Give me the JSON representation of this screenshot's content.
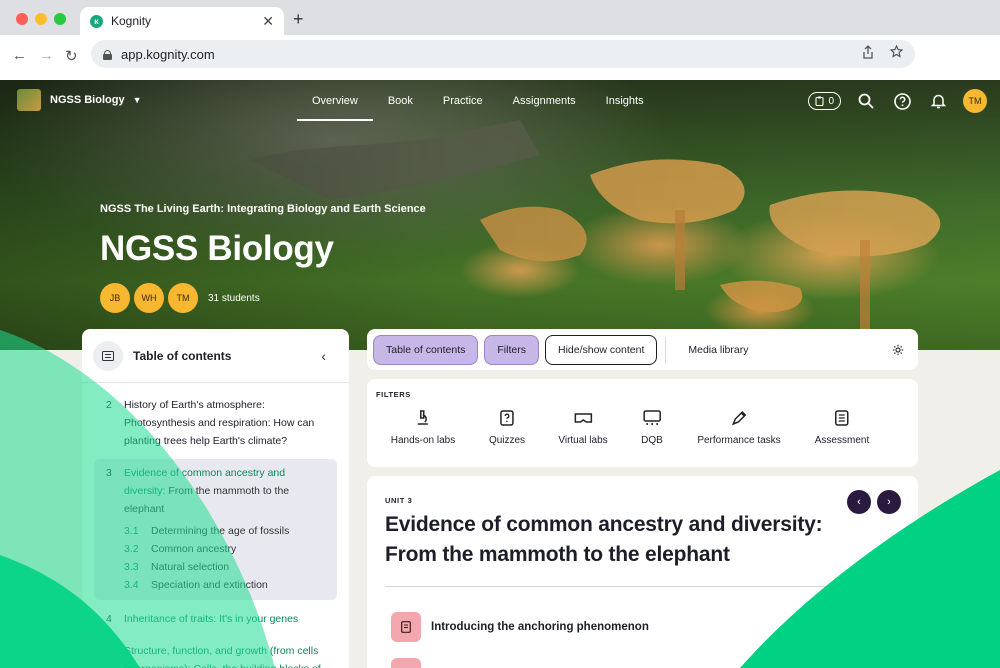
{
  "browser": {
    "tab_title": "Kognity",
    "tab_favicon": "kognity-logo-icon",
    "url": "app.kognity.com"
  },
  "nav": {
    "course_name": "NGSS Biology",
    "links": [
      "Overview",
      "Book",
      "Practice",
      "Assignments",
      "Insights"
    ],
    "active_link": "Overview",
    "notification_count": "0",
    "user_initials": "TM"
  },
  "hero": {
    "subtitle": "NGSS The Living Earth: Integrating Biology and Earth Science",
    "title": "NGSS Biology",
    "student_avatars": [
      "JB",
      "WH",
      "TM"
    ],
    "student_count": "31 students"
  },
  "toc": {
    "title": "Table of contents",
    "items": [
      {
        "num": "2",
        "label": "History of Earth's atmosphere: Photosynthesis and respiration: How can planting trees help Earth's climate?"
      }
    ],
    "active": {
      "num": "3",
      "label_green": "Evidence of common ancestry and diversity:",
      "label_rest": " From the mammoth to the elephant",
      "subitems": [
        {
          "num": "3.1",
          "label": "Determining the age of fossils"
        },
        {
          "num": "3.2",
          "label": "Common ancestry"
        },
        {
          "num": "3.3",
          "label": "Natural selection"
        },
        {
          "num": "3.4",
          "label": "Speciation and extinction"
        }
      ]
    },
    "after": [
      {
        "num": "4",
        "label": "Inheritance of traits: It's in your genes"
      },
      {
        "num": "",
        "label": "Structure, function, and growth (from cells to organisms): Cells, the building blocks of"
      }
    ]
  },
  "tabs": {
    "table_of_contents": "Table of contents",
    "filters": "Filters",
    "hide_show": "Hide/show content",
    "media_library": "Media library"
  },
  "filters": {
    "heading": "FILTERS",
    "items": [
      "Hands-on labs",
      "Quizzes",
      "Virtual labs",
      "DQB",
      "Performance tasks",
      "Assessment"
    ]
  },
  "unit": {
    "label": "UNIT 3",
    "title": "Evidence of common ancestry and diversity: From the mammoth to the elephant",
    "lessons": [
      "Introducing the anchoring phenomenon"
    ]
  },
  "colors": {
    "accent_green": "#1fdc92",
    "tab_purple": "#c6b7e6",
    "link_green": "#11845b",
    "avatar_yellow": "#f7b731",
    "pager_dark": "#2a1a3f",
    "lesson_pink": "#f2a6ad"
  }
}
